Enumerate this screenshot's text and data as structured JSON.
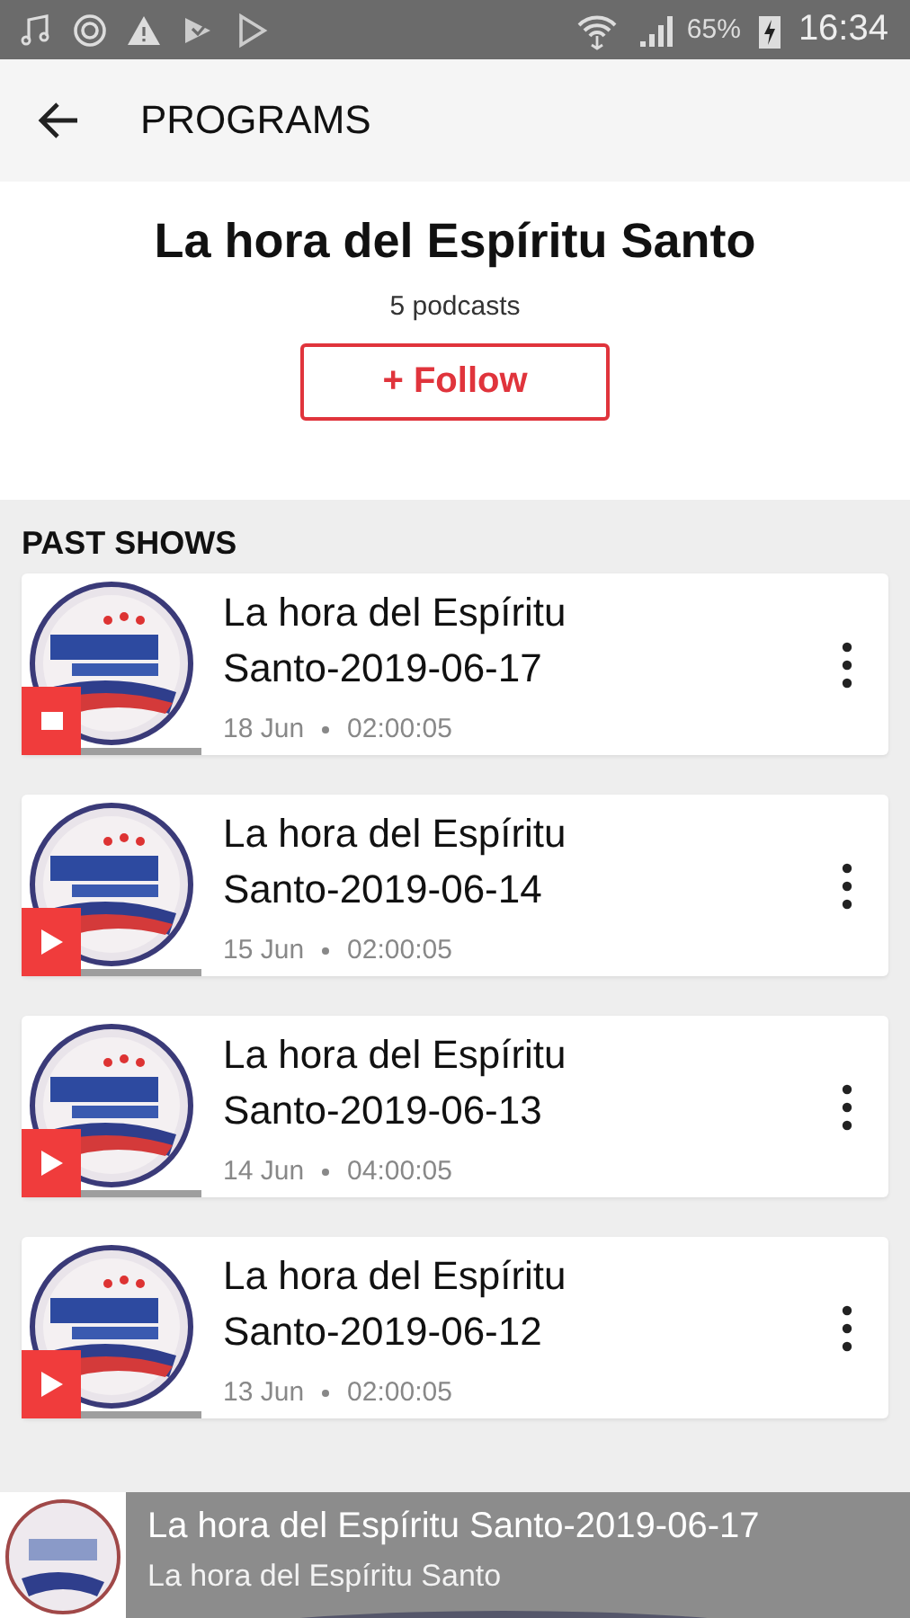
{
  "status_bar": {
    "battery": "65%",
    "time": "16:34"
  },
  "header": {
    "title": "PROGRAMS"
  },
  "program": {
    "title": "La hora del Espíritu Santo",
    "count": "5 podcasts",
    "follow_label": "+ Follow"
  },
  "past_shows": {
    "heading": "PAST SHOWS",
    "episodes": [
      {
        "title": "La hora del Espíritu Santo-2019-06-17",
        "date": "18 Jun",
        "duration": "02:00:05",
        "playing": true
      },
      {
        "title": "La hora del Espíritu Santo-2019-06-14",
        "date": "15 Jun",
        "duration": "02:00:05",
        "playing": false
      },
      {
        "title": "La hora del Espíritu Santo-2019-06-13",
        "date": "14 Jun",
        "duration": "04:00:05",
        "playing": false
      },
      {
        "title": "La hora del Espíritu Santo-2019-06-12",
        "date": "13 Jun",
        "duration": "02:00:05",
        "playing": false
      }
    ]
  },
  "mini_player": {
    "title": "La hora del Espíritu Santo-2019-06-17",
    "subtitle": "La hora del Espíritu Santo"
  }
}
